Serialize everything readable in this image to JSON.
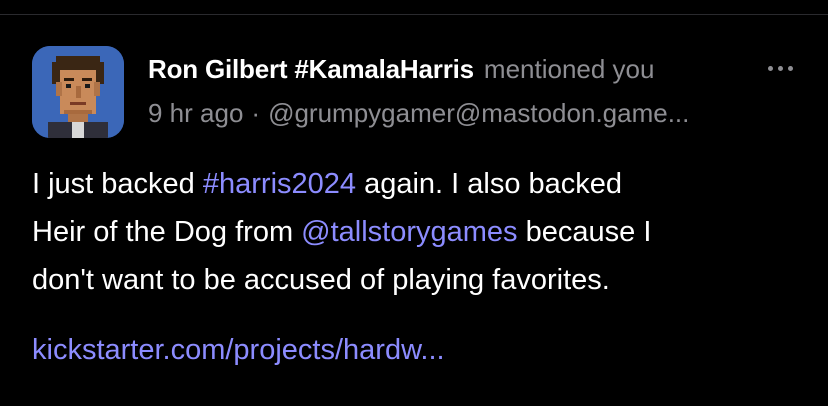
{
  "notification": {
    "author": {
      "display_name": "Ron Gilbert #KamalaHarris",
      "avatar_icon": "pixel-art-portrait-avatar"
    },
    "action": "mentioned you",
    "time": "9 hr ago",
    "separator": "·",
    "handle": "@grumpygamer@mastodon.game...",
    "more_icon": "ellipsis-icon"
  },
  "post": {
    "t1": "I just backed ",
    "hashtag": "#harris2024",
    "t2": " again. I also backed",
    "t3": "Heir of the Dog from ",
    "mention": "@tallstorygames",
    "t4": " because I",
    "t5": "don't want to be accused of playing favorites.",
    "link": "kickstarter.com/projects/hardw..."
  },
  "colors": {
    "background": "#000000",
    "text": "#ffffff",
    "muted": "#8e8e93",
    "link": "#8c8cff",
    "avatar_bg": "#3b67b8"
  }
}
